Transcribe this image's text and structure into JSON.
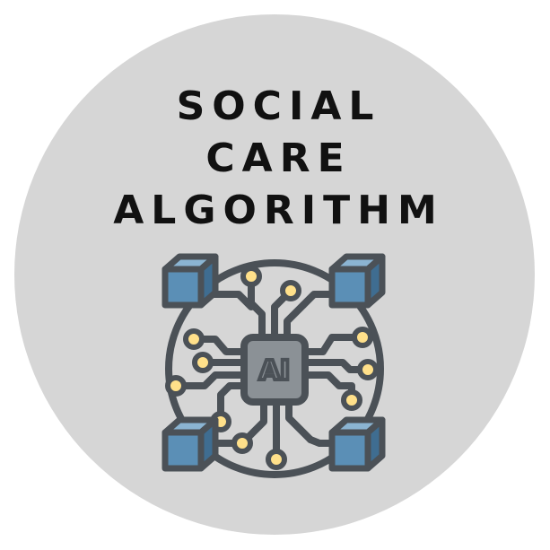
{
  "title": {
    "line1": "SOCIAL",
    "line2": "CARE",
    "line3": "ALGORITHM"
  },
  "chip": {
    "label": "AI"
  },
  "icon": {
    "name": "ai-circuit-icon"
  },
  "colors": {
    "background": "#ffffff",
    "disc": "#d6d6d6",
    "text": "#111111",
    "outline": "#4b5157",
    "cube_front": "#5b8fb6",
    "cube_top": "#8bb4d2",
    "cube_side": "#3f6d91",
    "chip_fill": "#8b9196",
    "node_fill": "#ffe08a"
  }
}
